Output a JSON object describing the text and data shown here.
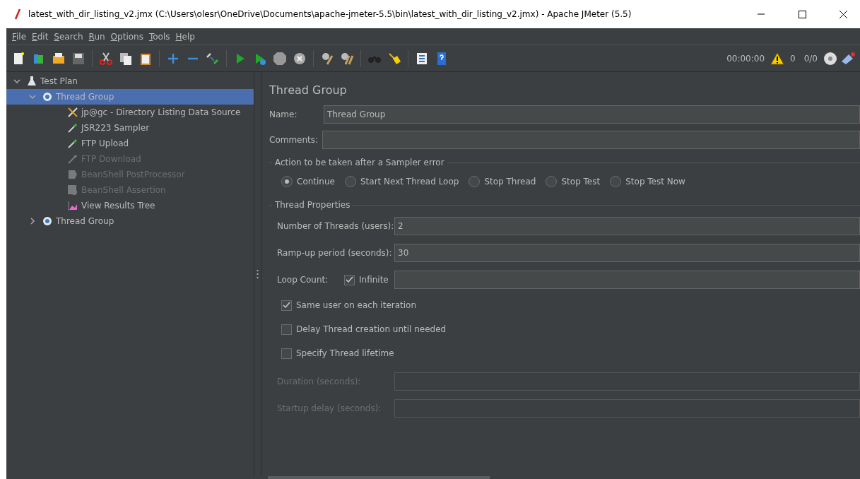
{
  "window": {
    "title": "latest_with_dir_listing_v2.jmx (C:\\Users\\olesr\\OneDrive\\Documents\\apache-jmeter-5.5\\bin\\latest_with_dir_listing_v2.jmx) - Apache JMeter (5.5)"
  },
  "menu": [
    "File",
    "Edit",
    "Search",
    "Run",
    "Options",
    "Tools",
    "Help"
  ],
  "status": {
    "elapsed": "00:00:00",
    "warnings": "0",
    "threads": "0/0"
  },
  "tree": [
    {
      "label": "Test Plan",
      "kind": "plan",
      "expanded": true,
      "selected": false,
      "enabled": true,
      "children": [
        {
          "label": "Thread Group",
          "kind": "group",
          "expanded": true,
          "selected": true,
          "enabled": true,
          "children": [
            {
              "label": "jp@gc - Directory Listing Data Source",
              "kind": "config",
              "selected": false,
              "enabled": true
            },
            {
              "label": "JSR223 Sampler",
              "kind": "sampler",
              "selected": false,
              "enabled": true
            },
            {
              "label": "FTP Upload",
              "kind": "sampler",
              "selected": false,
              "enabled": true
            },
            {
              "label": "FTP Download",
              "kind": "sampler",
              "selected": false,
              "enabled": false
            },
            {
              "label": "BeanShell PostProcessor",
              "kind": "postprocessor",
              "selected": false,
              "enabled": false
            },
            {
              "label": "BeanShell Assertion",
              "kind": "assertion",
              "selected": false,
              "enabled": false
            },
            {
              "label": "View Results Tree",
              "kind": "listener",
              "selected": false,
              "enabled": true
            }
          ]
        },
        {
          "label": "Thread Group",
          "kind": "group",
          "expanded": false,
          "selected": false,
          "enabled": true
        }
      ]
    }
  ],
  "panel": {
    "title": "Thread Group",
    "name": {
      "label": "Name:",
      "value": "Thread Group"
    },
    "comments": {
      "label": "Comments:"
    },
    "error_action": {
      "legend": "Action to be taken after a Sampler error",
      "options": [
        {
          "label": "Continue",
          "selected": true
        },
        {
          "label": "Start Next Thread Loop",
          "selected": false
        },
        {
          "label": "Stop Thread",
          "selected": false
        },
        {
          "label": "Stop Test",
          "selected": false
        },
        {
          "label": "Stop Test Now",
          "selected": false
        }
      ]
    },
    "thread_properties": {
      "legend": "Thread Properties",
      "fields": [
        {
          "label": "Number of Threads (users):",
          "value": "2"
        },
        {
          "label": "Ramp-up period (seconds):",
          "value": "30"
        }
      ],
      "loop_count": {
        "label": "Loop Count:",
        "infinite_label": "Infinite",
        "infinite_checked": true
      },
      "options": [
        {
          "label": "Same user on each iteration",
          "checked": true
        },
        {
          "label": "Delay Thread creation until needed",
          "checked": false
        },
        {
          "label": "Specify Thread lifetime",
          "checked": false
        }
      ],
      "lifetime_fields": [
        {
          "label": "Duration (seconds):",
          "disabled": true
        },
        {
          "label": "Startup delay (seconds):",
          "disabled": true
        }
      ]
    }
  }
}
